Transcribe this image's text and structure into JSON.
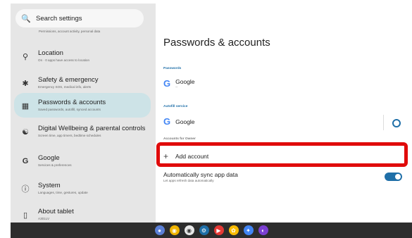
{
  "search": {
    "placeholder": "Search settings"
  },
  "sidebar": {
    "first_subtitle": "Permissions, account activity, personal data",
    "items": [
      {
        "title": "Location",
        "subtitle": "On · 0 apps have access to location"
      },
      {
        "title": "Safety & emergency",
        "subtitle": "Emergency SOS, medical info, alerts"
      },
      {
        "title": "Passwords & accounts",
        "subtitle": "Saved passwords, autofill, synced accounts"
      },
      {
        "title": "Digital Wellbeing & parental controls",
        "subtitle": "Screen time, app timers, bedtime schedules"
      },
      {
        "title": "Google",
        "subtitle": "Services & preferences"
      },
      {
        "title": "System",
        "subtitle": "Languages, time, gestures, update"
      },
      {
        "title": "About tablet",
        "subtitle": "A301LV"
      }
    ]
  },
  "main": {
    "title": "Passwords & accounts",
    "passwords_section": "Passwords",
    "passwords_item": "Google",
    "passwords_item_sub": "--",
    "autofill_section": "Autofill service",
    "autofill_item": "Google",
    "accounts_section": "Accounts for Owner",
    "add_account": "Add account",
    "sync_title": "Automatically sync app data",
    "sync_subtitle": "Let apps refresh data automatically",
    "sync_enabled": true
  },
  "dock": {
    "icons": [
      "launcher-icon",
      "chrome-icon",
      "camera-icon",
      "settings-icon",
      "youtube-icon",
      "photos-icon",
      "gemini-icon",
      "play-games-icon"
    ]
  },
  "colors": {
    "accent": "#1f6fa8",
    "highlight": "#e00b0b",
    "selected_bg": "#cde3e7"
  }
}
